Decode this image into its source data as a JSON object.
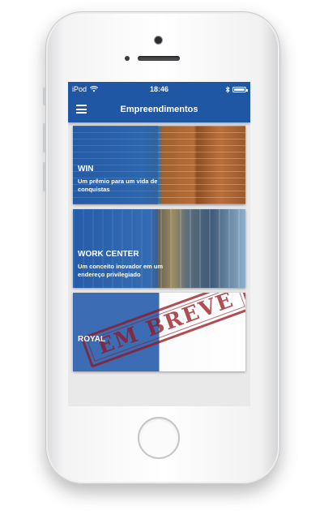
{
  "status_bar": {
    "carrier": "iPod",
    "time": "18:46",
    "battery_level": 1.0
  },
  "app_bar": {
    "title": "Empreendimentos",
    "menu_icon": "menu-icon"
  },
  "cards": [
    {
      "name": "WIN",
      "description": "Um prêmio para um vida de conquistas"
    },
    {
      "name": "WORK CENTER",
      "description": "Um conceito inovador em um endereço privilegiado"
    },
    {
      "name": "ROYAL",
      "stamp": "EM BREVE"
    }
  ],
  "colors": {
    "primary": "#2057a4",
    "stamp": "#96141a"
  }
}
